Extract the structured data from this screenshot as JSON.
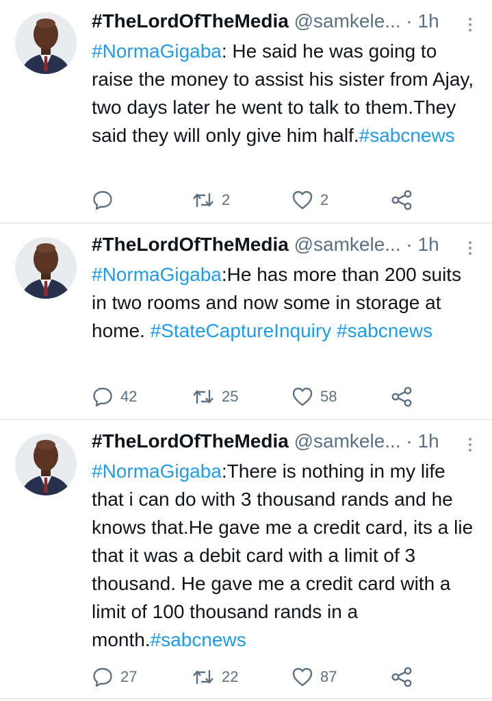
{
  "tweets": [
    {
      "author_name": "#TheLordOfTheMedia",
      "handle": "@samkele...",
      "separator": "·",
      "time": "1h",
      "text": [
        {
          "t": "#NormaGigaba",
          "tag": true
        },
        {
          "t": ": He said he was going to raise the money to assist his sister from Ajay, two days later he went to talk to them.They said they will only give him half.",
          "tag": false
        },
        {
          "t": "#sabcnews",
          "tag": true
        }
      ],
      "reply_count": "",
      "retweet_count": "2",
      "like_count": "2"
    },
    {
      "author_name": "#TheLordOfTheMedia",
      "handle": "@samkele...",
      "separator": "·",
      "time": "1h",
      "text": [
        {
          "t": "#NormaGigaba",
          "tag": true
        },
        {
          "t": ":He has more than 200 suits in two rooms and now some in storage at home.  ",
          "tag": false
        },
        {
          "t": "#StateCaptureInquiry",
          "tag": true
        },
        {
          "t": " ",
          "tag": false
        },
        {
          "t": "#sabcnews",
          "tag": true
        }
      ],
      "reply_count": "42",
      "retweet_count": "25",
      "like_count": "58"
    },
    {
      "author_name": "#TheLordOfTheMedia",
      "handle": "@samkele...",
      "separator": "·",
      "time": "1h",
      "text": [
        {
          "t": "#NormaGigaba",
          "tag": true
        },
        {
          "t": ":There is nothing in my life that i can do with 3 thousand rands and he knows that.He gave me a credit card, its a lie that it was a debit card with a limit of 3 thousand. He gave me a credit card with a limit of 100 thousand rands in a month.",
          "tag": false
        },
        {
          "t": "#sabcnews",
          "tag": true
        }
      ],
      "reply_count": "27",
      "retweet_count": "22",
      "like_count": "87"
    }
  ],
  "icons": {
    "reply": "speech-bubble-icon",
    "retweet": "retweet-arrows-icon",
    "like": "heart-icon",
    "share": "share-nodes-icon",
    "more": "vertical-ellipsis-icon"
  },
  "colors": {
    "hashtag": "#1d9bf0",
    "secondary_text": "#5b7083",
    "primary_text": "#0f1419",
    "divider": "#d6dce0"
  }
}
